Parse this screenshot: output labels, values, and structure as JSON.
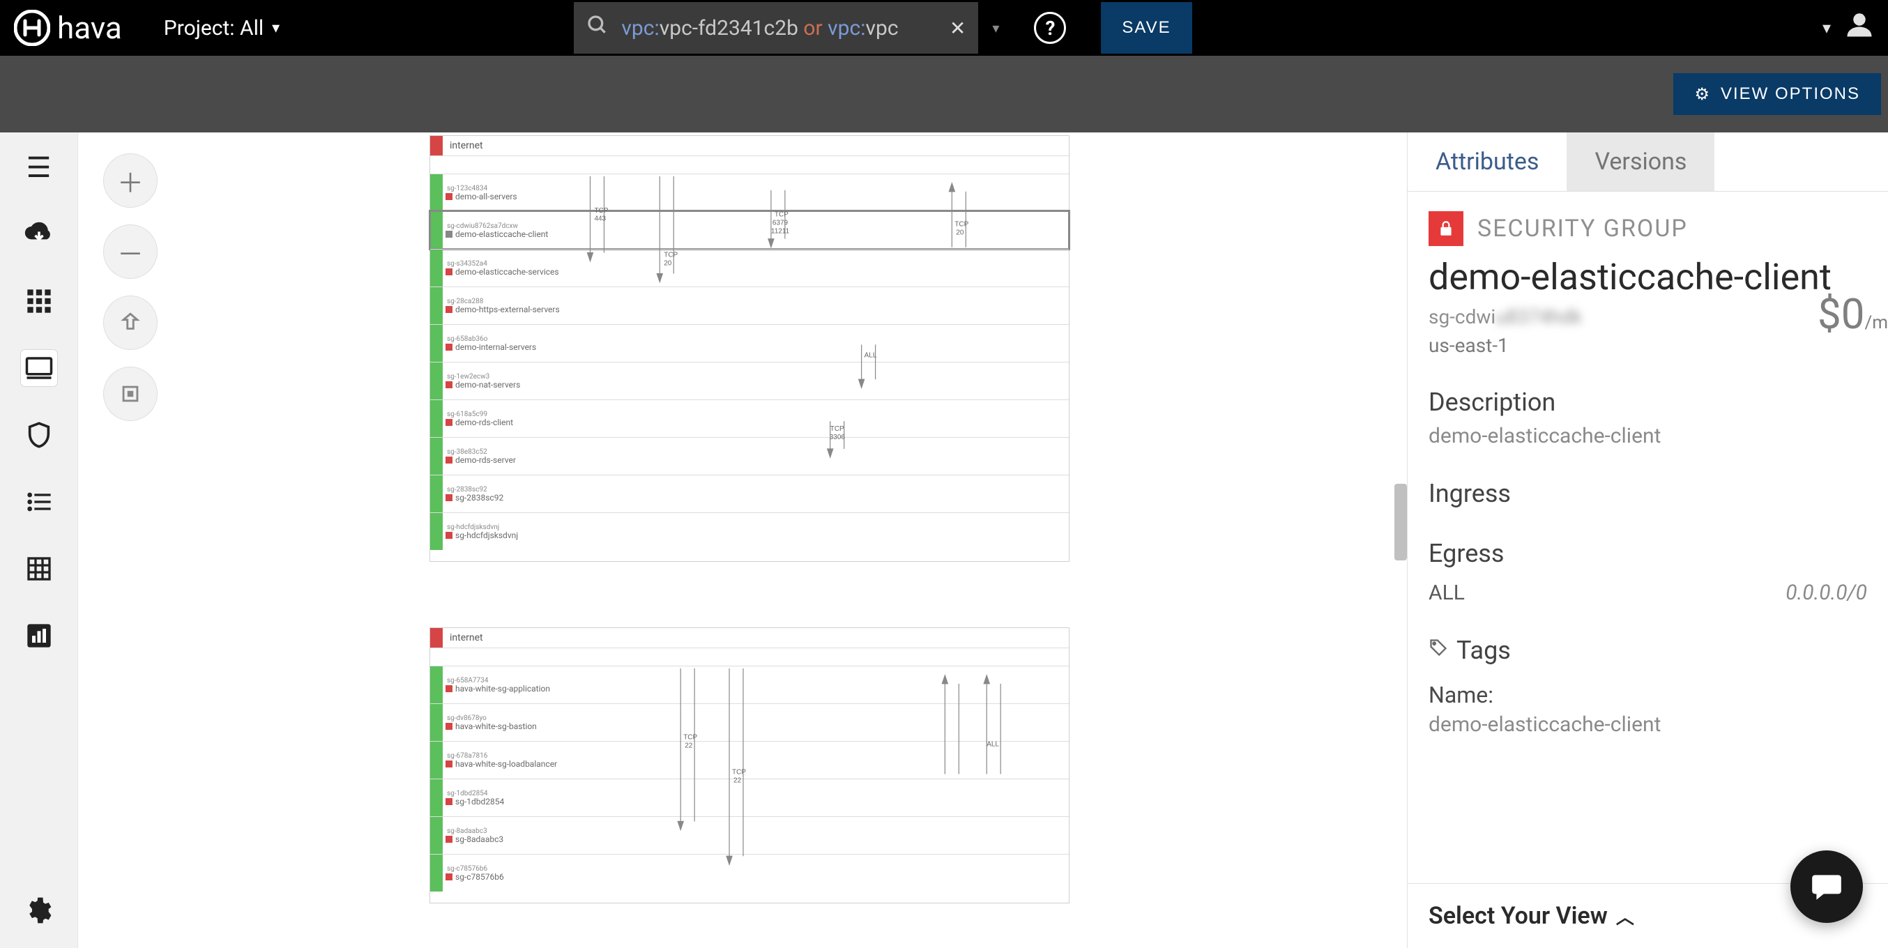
{
  "brand": "hava",
  "project": {
    "label": "Project: All"
  },
  "search": {
    "prefix1": "vpc:",
    "value1": "vpc-fd2341c2b",
    "op": "or",
    "prefix2": "vpc:",
    "value2": "vpc"
  },
  "save_label": "SAVE",
  "view_options_label": "VIEW OPTIONS",
  "tabs": {
    "attributes": "Attributes",
    "versions": "Versions"
  },
  "sg": {
    "type_label": "SECURITY GROUP",
    "name": "demo-elasticcache-client",
    "id_prefix": "sg-cdwi",
    "id_blur": "u8374hdk",
    "region": "us-east-1",
    "price_main": "$0",
    "price_per": "/m",
    "description_h": "Description",
    "description_v": "demo-elasticcache-client",
    "ingress_h": "Ingress",
    "egress_h": "Egress",
    "egress_rows": [
      {
        "k": "ALL",
        "v": "0.0.0.0/0"
      }
    ],
    "tags_h": "Tags",
    "tags": [
      {
        "k": "Name:",
        "v": "demo-elasticcache-client"
      }
    ]
  },
  "select_view_label": "Select Your View",
  "diagram1": {
    "internet": "internet",
    "rows": [
      {
        "id": "sg-123c4834",
        "name": "demo-all-servers",
        "sel": false
      },
      {
        "id": "sg-cdwiu8762sa7dcxw",
        "name": "demo-elasticcache-client",
        "sel": true
      },
      {
        "id": "sg-s34352a4",
        "name": "demo-elasticcache-services",
        "sel": false
      },
      {
        "id": "sg-28ca288",
        "name": "demo-https-external-servers",
        "sel": false
      },
      {
        "id": "sg-658ab36o",
        "name": "demo-internal-servers",
        "sel": false
      },
      {
        "id": "sg-1ew2ecw3",
        "name": "demo-nat-servers",
        "sel": false
      },
      {
        "id": "sg-618a5c99",
        "name": "demo-rds-client",
        "sel": false
      },
      {
        "id": "sg-38e83c52",
        "name": "demo-rds-server",
        "sel": false
      },
      {
        "id": "sg-2838sc92",
        "name": "sg-2838sc92",
        "sel": false
      },
      {
        "id": "sg-hdcfdjsksdvnj",
        "name": "sg-hdcfdjsksdvnj",
        "sel": false
      }
    ],
    "arrow_labels": {
      "tcp": "TCP",
      "p443": "443",
      "p20": "20",
      "p6379": "6379",
      "p11211": "11211",
      "p3306": "3306",
      "all": "ALL"
    }
  },
  "diagram2": {
    "internet": "internet",
    "rows": [
      {
        "id": "sg-658A7734",
        "name": "hava-white-sg-application"
      },
      {
        "id": "sg-dv8678yo",
        "name": "hava-white-sg-bastion"
      },
      {
        "id": "sg-678a7816",
        "name": "hava-white-sg-loadbalancer"
      },
      {
        "id": "sg-1dbd2854",
        "name": "sg-1dbd2854"
      },
      {
        "id": "sg-8adaabc3",
        "name": "sg-8adaabc3"
      },
      {
        "id": "sg-c78576b6",
        "name": "sg-c78576b6"
      }
    ],
    "arrow_labels": {
      "tcp": "TCP",
      "p22": "22",
      "all": "ALL"
    }
  }
}
